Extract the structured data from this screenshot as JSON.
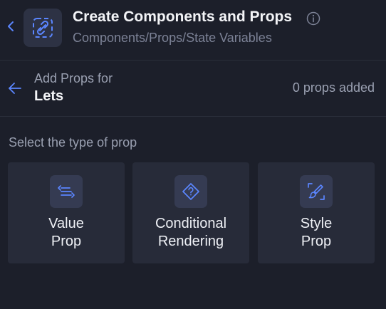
{
  "header": {
    "title": "Create Components and Props",
    "breadcrumb": "Components/Props/State Variables",
    "icon": "link-icon",
    "back_icon": "chevron-left-icon",
    "info_icon": "info-icon"
  },
  "subheader": {
    "label": "Add Props for",
    "component_name": "Lets",
    "props_count": "0 props added",
    "back_icon": "arrow-left-icon"
  },
  "prop_types": {
    "label": "Select the type of prop",
    "cards": [
      {
        "label": "Value\nProp",
        "icon": "value-list-icon"
      },
      {
        "label": "Conditional\nRendering",
        "icon": "question-diamond-icon"
      },
      {
        "label": "Style\nProp",
        "icon": "brush-icon"
      }
    ]
  },
  "colors": {
    "background": "#1c1f2a",
    "card": "#272b39",
    "icon_box": "#353b52",
    "accent": "#4c7dff",
    "muted_text": "#7c8296"
  }
}
